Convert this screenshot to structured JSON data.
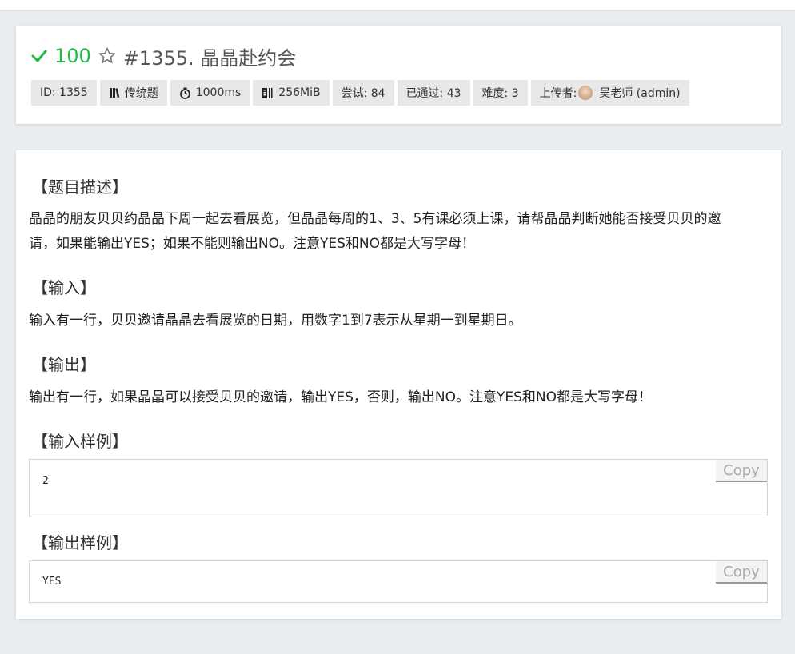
{
  "header": {
    "score": "100",
    "title": "#1355. 晶晶赴约会",
    "labels": [
      {
        "icon": "id",
        "text": "ID: 1355"
      },
      {
        "icon": "book-icon",
        "text": "传统题"
      },
      {
        "icon": "stopwatch-icon",
        "text": "1000ms"
      },
      {
        "icon": "memory-icon",
        "text": "256MiB"
      },
      {
        "icon": "",
        "text": "尝试: 84"
      },
      {
        "icon": "",
        "text": "已通过: 43"
      },
      {
        "icon": "",
        "text": "难度: 3"
      },
      {
        "icon": "avatar",
        "prefix": "上传者:",
        "text": "吴老师 (admin)"
      }
    ]
  },
  "sections": {
    "description_title": "【题目描述】",
    "description_line1": "晶晶的朋友贝贝约晶晶下周一起去看展览，但晶晶每周的1、3、5有课必须上课，请帮晶晶判断她能否接受贝贝的邀",
    "description_line2": "请，如果能输出YES；如果不能则输出NO。注意YES和NO都是大写字母！",
    "input_title": "【输入】",
    "input_text": "输入有一行，贝贝邀请晶晶去看展览的日期，用数字1到7表示从星期一到星期日。",
    "output_title": "【输出】",
    "output_text": "输出有一行，如果晶晶可以接受贝贝的邀请，输出YES，否则，输出NO。注意YES和NO都是大写字母！",
    "sample_input_title": "【输入样例】",
    "sample_input": "2",
    "sample_output_title": "【输出样例】",
    "sample_output": "YES",
    "copy_label": "Copy"
  },
  "colors": {
    "accent_green": "#21ba45",
    "background": "#e9edf0"
  }
}
